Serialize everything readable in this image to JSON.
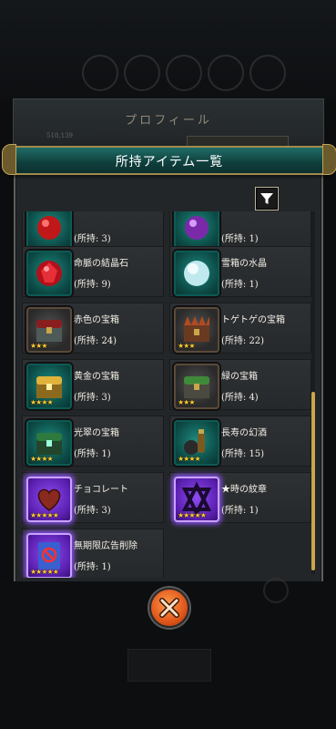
{
  "profile": {
    "title": "プロフィール",
    "sub": "518,139"
  },
  "modal": {
    "title": "所持アイテム一覧"
  },
  "items": [
    {
      "name": "",
      "count": "(所持: 3)",
      "icon": "red-orb-icon",
      "frame": "teal",
      "stars": ""
    },
    {
      "name": "",
      "count": "(所持: 1)",
      "icon": "purple-orb-icon",
      "frame": "teal",
      "stars": ""
    },
    {
      "name": "命脈の結晶石",
      "count": "(所持: 9)",
      "icon": "red-crystal-icon",
      "frame": "teal",
      "stars": ""
    },
    {
      "name": "雪箱の水晶",
      "count": "(所持: 1)",
      "icon": "snow-crystal-icon",
      "frame": "teal",
      "stars": ""
    },
    {
      "name": "赤色の宝箱",
      "count": "(所持: 24)",
      "icon": "red-treasure-chest-icon",
      "frame": "dark",
      "stars": "★★★"
    },
    {
      "name": "トゲトゲの宝箱",
      "count": "(所持: 22)",
      "icon": "spiky-treasure-chest-icon",
      "frame": "dark",
      "stars": "★★★"
    },
    {
      "name": "黄金の宝箱",
      "count": "(所持: 3)",
      "icon": "gold-treasure-chest-icon",
      "frame": "teal",
      "stars": "★★★★"
    },
    {
      "name": "緑の宝箱",
      "count": "(所持: 4)",
      "icon": "green-treasure-chest-icon",
      "frame": "dark",
      "stars": "★★★"
    },
    {
      "name": "光翠の宝箱",
      "count": "(所持: 1)",
      "icon": "jade-treasure-chest-icon",
      "frame": "teal",
      "stars": "★★★★"
    },
    {
      "name": "長寿の幻酒",
      "count": "(所持: 15)",
      "icon": "elixir-bottle-icon",
      "frame": "teal",
      "stars": "★★★★"
    },
    {
      "name": "チョコレート",
      "count": "(所持: 3)",
      "icon": "chocolate-heart-icon",
      "frame": "purple",
      "stars": "★★★★★"
    },
    {
      "name": "★時の紋章",
      "count": "(所持: 1)",
      "icon": "time-crest-icon",
      "frame": "purple",
      "stars": "★★★★★"
    },
    {
      "name": "無期限広告削除",
      "count": "(所持: 1)",
      "icon": "ad-remove-ticket-icon",
      "frame": "purple",
      "stars": "★★★★★"
    }
  ]
}
